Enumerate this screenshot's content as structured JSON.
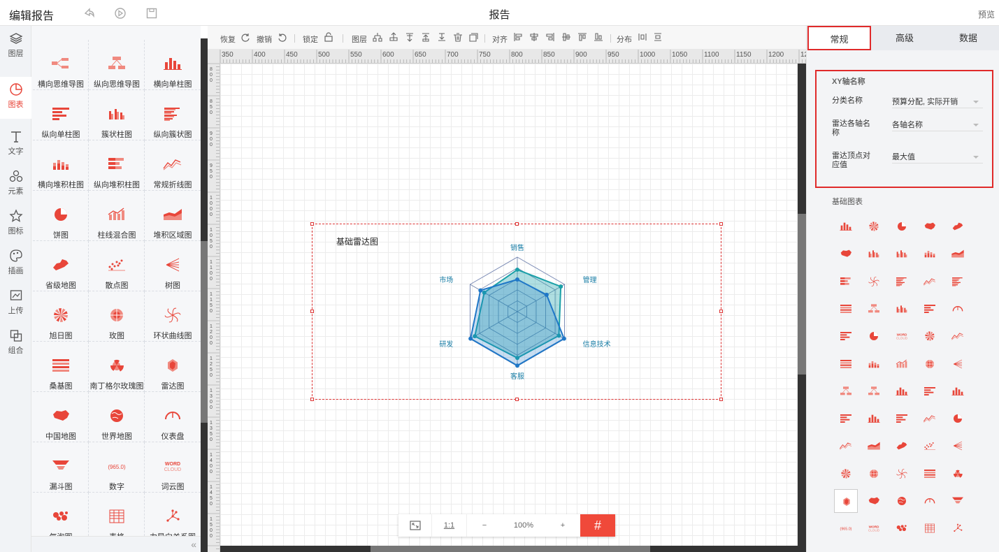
{
  "header": {
    "title": "编辑报告",
    "center_title": "报告",
    "preview": "预览"
  },
  "rail": [
    {
      "label": "图层",
      "icon": "layers-icon"
    },
    {
      "label": "图表",
      "icon": "chart-icon",
      "active": true
    },
    {
      "label": "文字",
      "icon": "text-icon"
    },
    {
      "label": "元素",
      "icon": "shapes-icon"
    },
    {
      "label": "图标",
      "icon": "star-icon"
    },
    {
      "label": "插画",
      "icon": "palette-icon"
    },
    {
      "label": "上传",
      "icon": "upload-icon"
    },
    {
      "label": "组合",
      "icon": "group-icon"
    }
  ],
  "library": [
    "横向思维导图",
    "纵向思维导图",
    "横向单柱图",
    "纵向单柱图",
    "簇状柱图",
    "纵向簇状图",
    "横向堆积柱图",
    "纵向堆积柱图",
    "常规折线图",
    "饼图",
    "柱线混合图",
    "堆积区域图",
    "省级地图",
    "散点图",
    "树图",
    "旭日图",
    "玫图",
    "环状曲线图",
    "桑基图",
    "南丁格尔玫瑰图",
    "雷达图",
    "中国地图",
    "世界地图",
    "仪表盘",
    "漏斗图",
    "数字",
    "词云图",
    "气泡图",
    "表格",
    "力导向关系图"
  ],
  "library_number_badge": "965.0",
  "library_wordcloud_badge": "WORD CLOUD",
  "toolbar": {
    "restore": "恢复",
    "undo": "撤销",
    "lock": "锁定",
    "layer": "图层",
    "align": "对齐",
    "distribute": "分布"
  },
  "ruler_h": [
    "350",
    "400",
    "450",
    "500",
    "550",
    "600",
    "650",
    "700",
    "750",
    "800",
    "850",
    "900",
    "950",
    "1000",
    "1050",
    "1100",
    "1150",
    "1200",
    "1250"
  ],
  "ruler_v": [
    "800",
    "850",
    "900",
    "950",
    "1000",
    "1050",
    "1100",
    "1150",
    "1200",
    "1250",
    "1300",
    "1350",
    "1400",
    "1450",
    "1500"
  ],
  "chart": {
    "title": "基础雷达图",
    "axes": [
      "销售",
      "管理",
      "信息技术",
      "客服",
      "研发",
      "市场"
    ],
    "series_values": [
      [
        0.77,
        0.92,
        0.88,
        0.85,
        0.9,
        0.7
      ],
      [
        0.59,
        0.62,
        0.99,
        0.99,
        0.99,
        0.78
      ]
    ],
    "colors": [
      "#1aa0a8",
      "#1f77c7"
    ]
  },
  "zoom": {
    "fit": "fit-screen-icon",
    "ratio": "1:1",
    "minus": "−",
    "value": "100%",
    "plus": "+",
    "grid": "#"
  },
  "right": {
    "tabs": [
      "常规",
      "高级",
      "数据"
    ],
    "section": "XY轴名称",
    "rows": [
      {
        "label": "分类名称",
        "value": "预算分配, 实际开销"
      },
      {
        "label": "雷达各轴名称",
        "value": "各轴名称"
      },
      {
        "label": "雷达顶点对应值",
        "value": "最大值"
      }
    ],
    "basic_charts_label": "基础图表",
    "thumb_badge": "965.0",
    "thumb_word": "WORD"
  }
}
